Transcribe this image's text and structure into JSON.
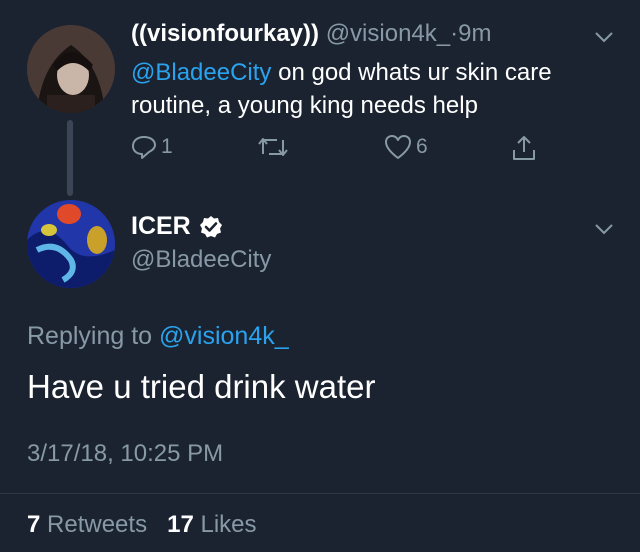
{
  "reply_tweet": {
    "display_name": "((visionfourkay))",
    "handle": "@vision4k_",
    "separator": "·",
    "time": "9m",
    "mention": "@BladeeCity",
    "text": " on god whats ur skin care routine, a young king needs help",
    "reply_count": "1",
    "like_count": "6",
    "icons": [
      "reply-icon",
      "retweet-icon",
      "like-icon",
      "share-icon",
      "chevron-down-icon"
    ]
  },
  "main_tweet": {
    "display_name": "ICER",
    "verified_icon": "verified-badge-icon",
    "handle": "@BladeeCity",
    "replying_prefix": "Replying to ",
    "replying_to": "@vision4k_",
    "text": "Have u tried drink water",
    "timestamp": "3/17/18, 10:25 PM",
    "retweets_count": "7",
    "retweets_label": "Retweets",
    "likes_count": "17",
    "likes_label": "Likes"
  },
  "colors": {
    "background": "#1b2330",
    "link": "#2aa3ef",
    "muted": "#8899a6",
    "text": "#ffffff"
  }
}
